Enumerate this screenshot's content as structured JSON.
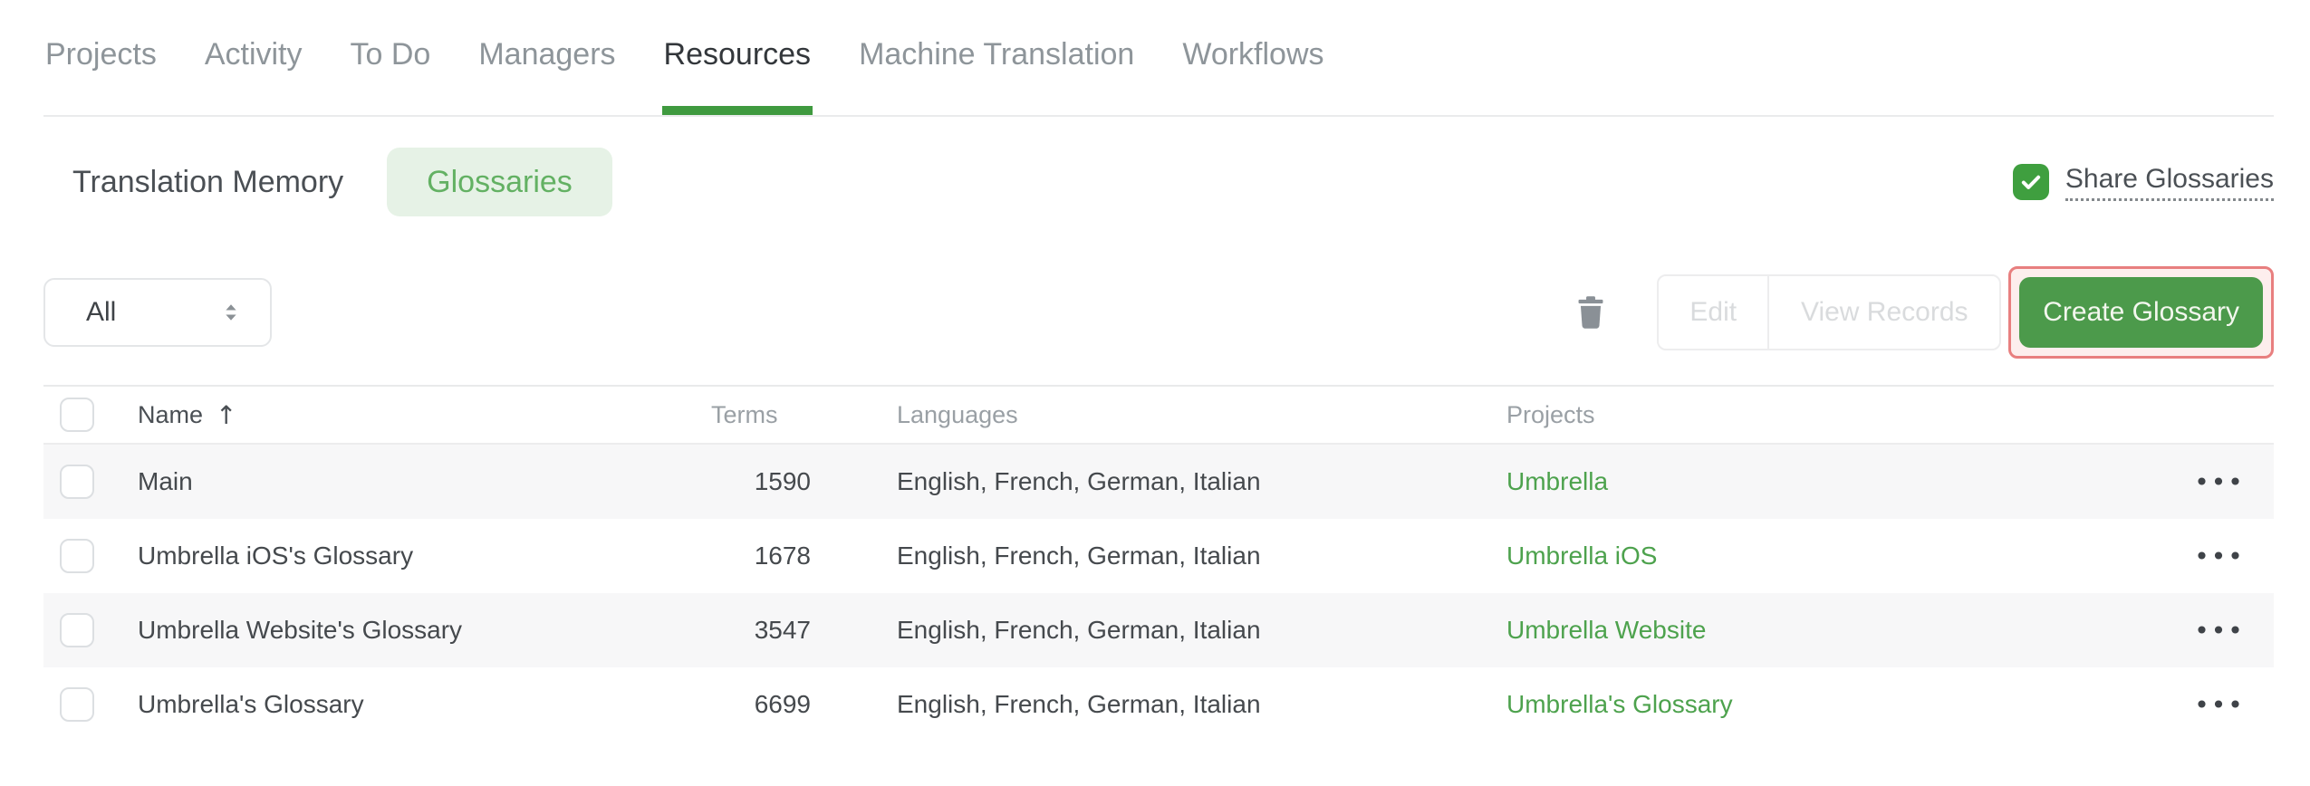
{
  "nav": {
    "tabs": [
      {
        "label": "Projects",
        "active": false
      },
      {
        "label": "Activity",
        "active": false
      },
      {
        "label": "To Do",
        "active": false
      },
      {
        "label": "Managers",
        "active": false
      },
      {
        "label": "Resources",
        "active": true
      },
      {
        "label": "Machine Translation",
        "active": false
      },
      {
        "label": "Workflows",
        "active": false
      }
    ]
  },
  "resource_tabs": {
    "translation_memory_label": "Translation Memory",
    "glossaries_label": "Glossaries"
  },
  "share_glossaries": {
    "label": "Share Glossaries",
    "checked": true
  },
  "toolbar": {
    "filter_value": "All",
    "edit_label": "Edit",
    "view_records_label": "View Records",
    "create_glossary_label": "Create Glossary"
  },
  "table": {
    "headers": {
      "name": "Name",
      "sort_indicator": "↑",
      "terms": "Terms",
      "languages": "Languages",
      "projects": "Projects"
    },
    "rows": [
      {
        "name": "Main",
        "terms": "1590",
        "languages": "English, French, German, Italian",
        "project": "Umbrella"
      },
      {
        "name": "Umbrella iOS's Glossary",
        "terms": "1678",
        "languages": "English, French, German, Italian",
        "project": "Umbrella iOS"
      },
      {
        "name": "Umbrella Website's Glossary",
        "terms": "3547",
        "languages": "English, French, German, Italian",
        "project": "Umbrella Website"
      },
      {
        "name": "Umbrella's Glossary",
        "terms": "6699",
        "languages": "English, French, German, Italian",
        "project": "Umbrella's Glossary"
      }
    ],
    "row_menu_glyph": "•••"
  },
  "icons": {
    "share_checkbox": "checkmark-icon",
    "filter_caret": "up-down-caret-icon",
    "delete": "trash-icon",
    "row_menu": "ellipsis-menu-icon",
    "sort": "arrow-up-icon"
  },
  "colors": {
    "accent_green": "#3f9a3f",
    "pill_green_bg": "#e6f2e6",
    "pill_green_text": "#63b163",
    "link_green": "#4da24d",
    "create_button_green": "#4c9a4b",
    "checkbox_green": "#3f9f3f",
    "highlight_ring": "#e87f7f",
    "highlight_fill": "#fdeeed",
    "row_alt_bg": "#f7f7f8",
    "muted_text": "#9aa0a5",
    "disabled_text": "#d9dbdd",
    "dark_text": "#33373b",
    "divider": "#e9eaeb"
  }
}
